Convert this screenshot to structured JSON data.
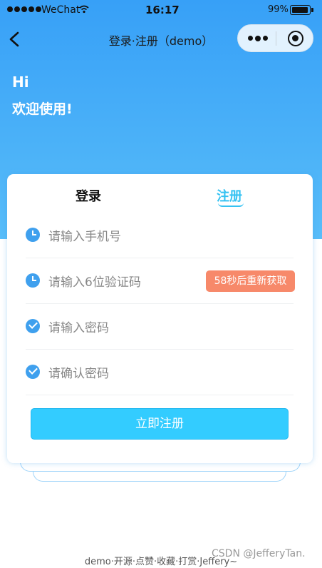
{
  "status_bar": {
    "carrier": "WeChat",
    "time": "16:17",
    "battery": "99%"
  },
  "nav": {
    "title": "登录·注册（demo）"
  },
  "greeting": {
    "line1": "Hi",
    "line2": "欢迎使用!"
  },
  "tabs": [
    {
      "label": "登录",
      "active": false
    },
    {
      "label": "注册",
      "active": true
    }
  ],
  "form": {
    "phone_placeholder": "请输入手机号",
    "code_placeholder": "请输入6位验证码",
    "code_button": "58秒后重新获取",
    "password_placeholder": "请输入密码",
    "confirm_placeholder": "请确认密码",
    "submit_label": "立即注册"
  },
  "footer": {
    "text": "demo·开源·点赞·收藏·打赏·Jeffery~"
  },
  "watermark": "CSDN @JefferyTan.",
  "colors": {
    "accent": "#35c2f2",
    "primary_button": "#33ccff",
    "code_button": "#f7896a",
    "header_gradient_top": "#37a0f7",
    "icon_blue": "#3fa0ee"
  }
}
